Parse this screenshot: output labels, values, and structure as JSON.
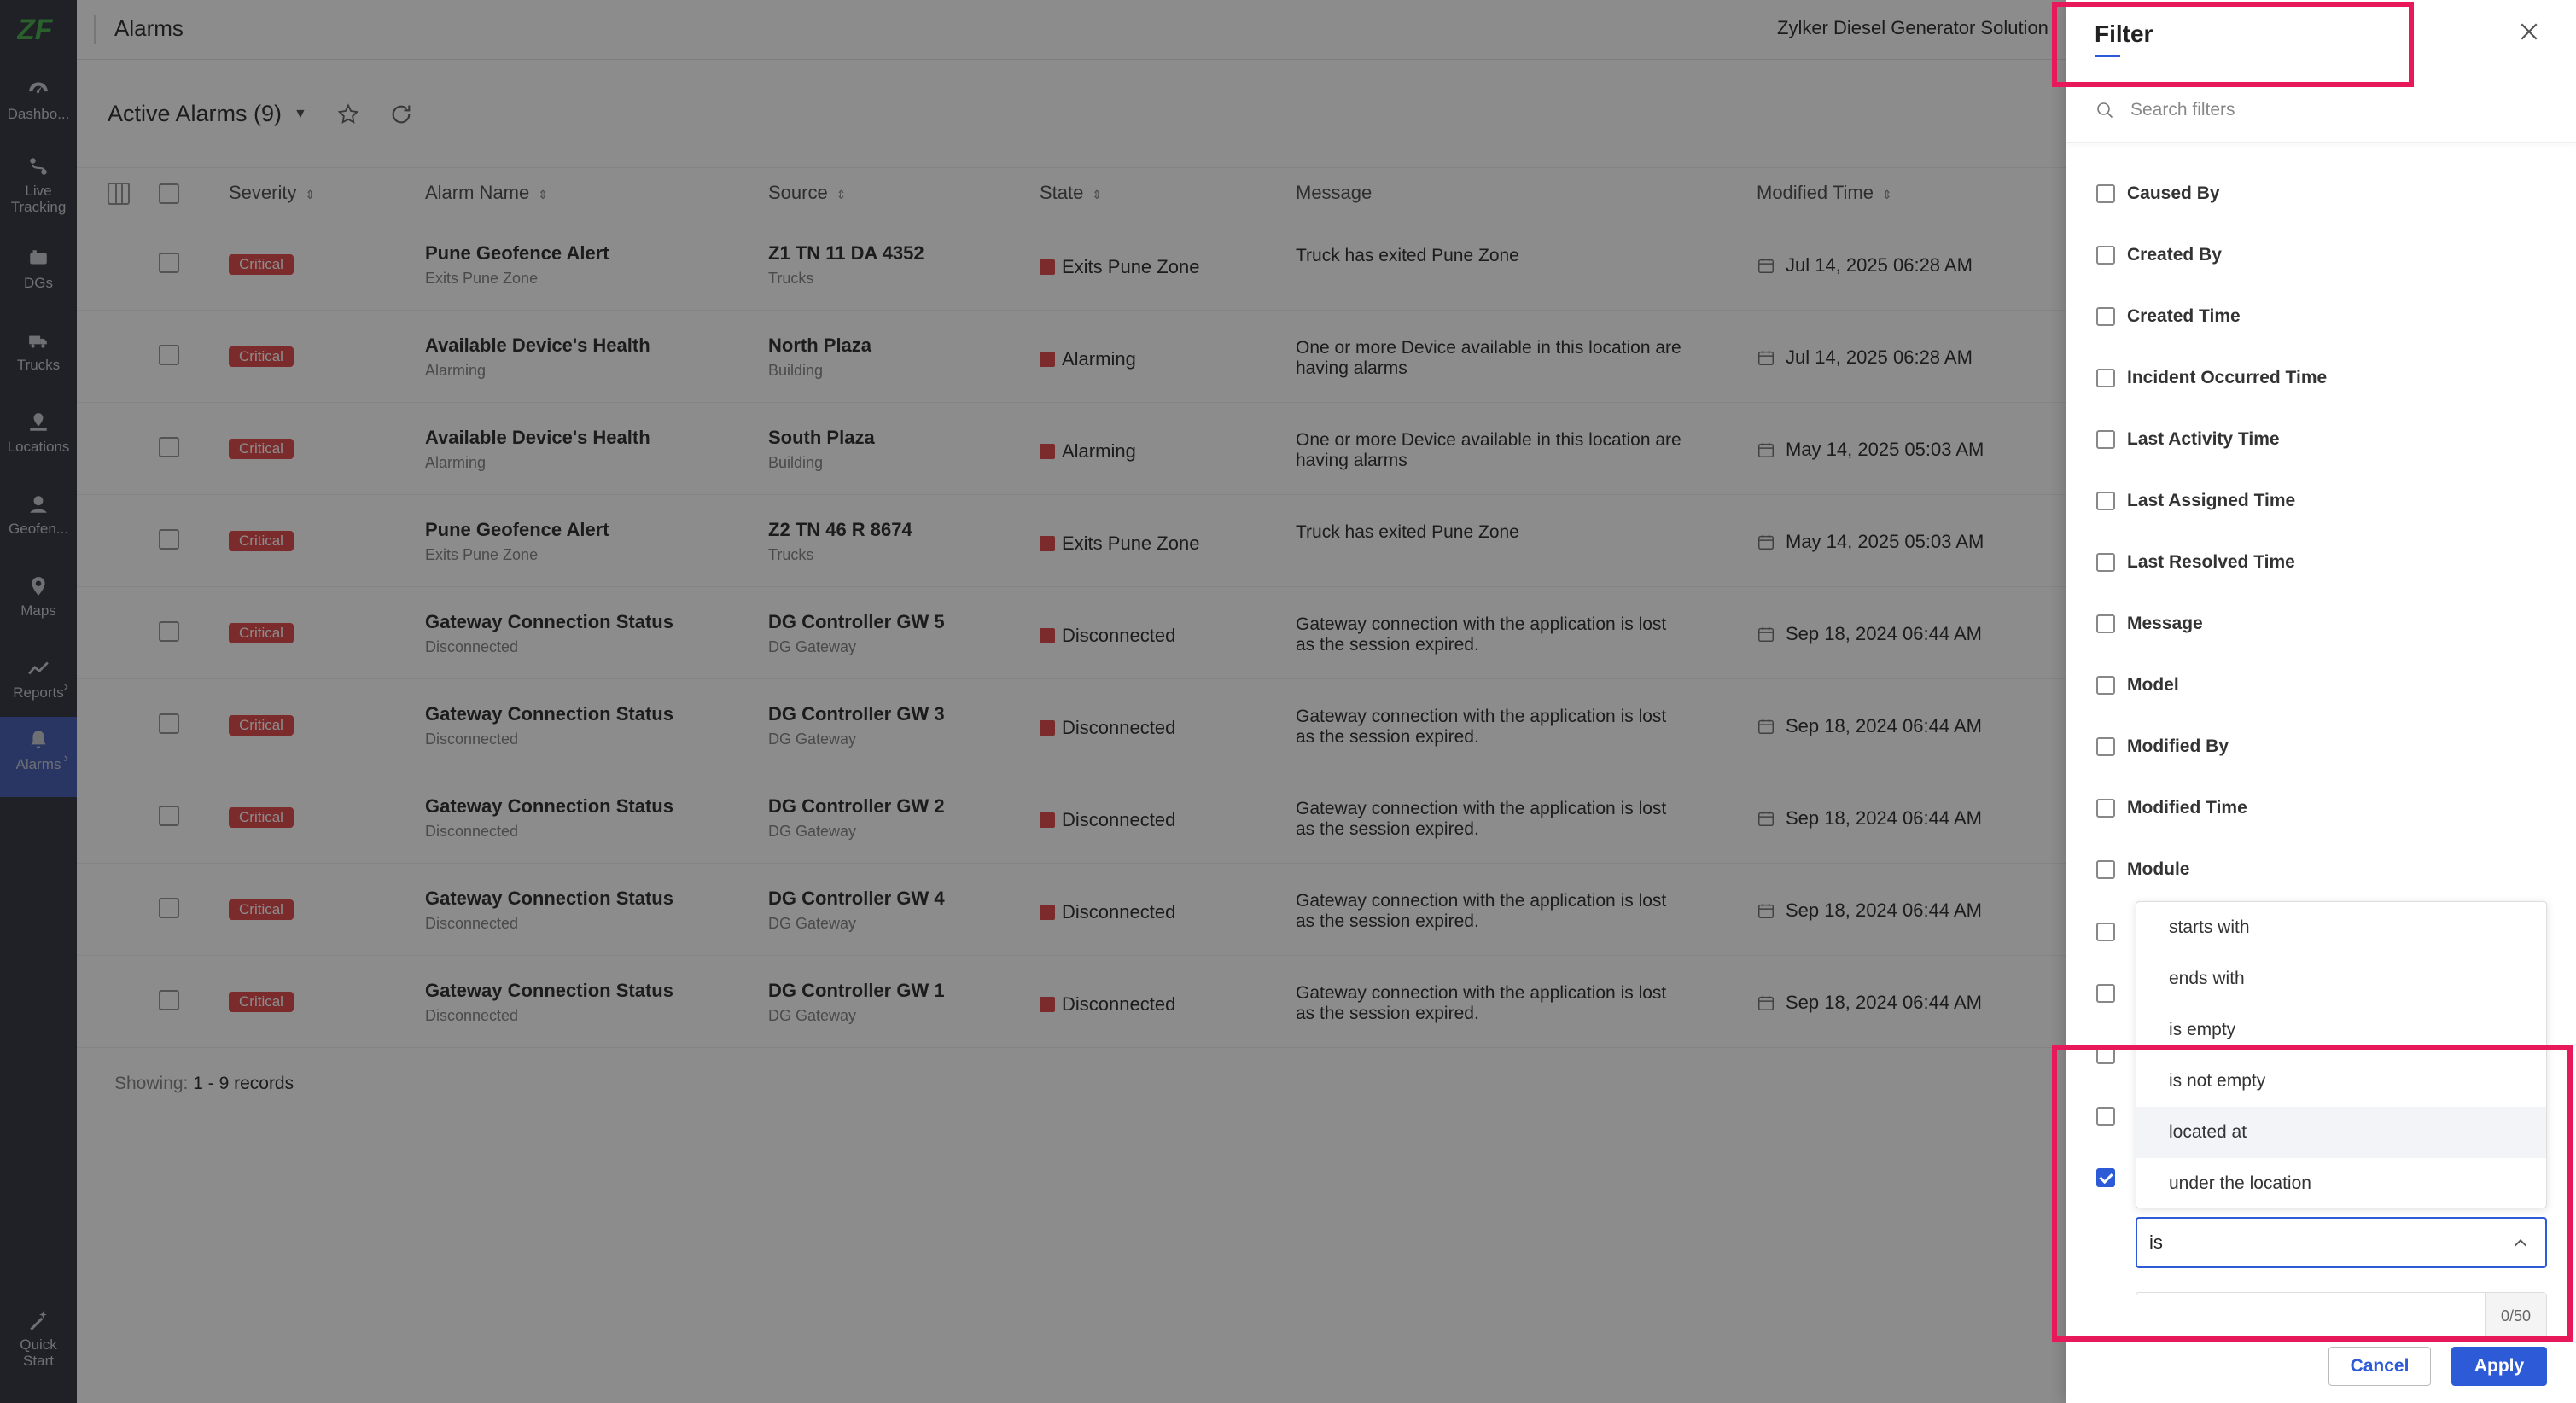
{
  "app": {
    "title": "Alarms",
    "org": "Zylker Diesel Generator Solution"
  },
  "nav": [
    {
      "label": "Dashbo...",
      "icon": "dashboard-icon"
    },
    {
      "label": "Live Tracking",
      "icon": "live-tracking-icon"
    },
    {
      "label": "DGs",
      "icon": "dg-icon"
    },
    {
      "label": "Trucks",
      "icon": "truck-icon"
    },
    {
      "label": "Locations",
      "icon": "locations-icon"
    },
    {
      "label": "Geofen...",
      "icon": "geofence-icon"
    },
    {
      "label": "Maps",
      "icon": "map-pin-icon"
    },
    {
      "label": "Reports",
      "icon": "reports-icon"
    },
    {
      "label": "Alarms",
      "icon": "bell-icon"
    },
    {
      "label": "Quick Start",
      "icon": "magic-wand-icon"
    }
  ],
  "view": {
    "title": "Active Alarms (9)"
  },
  "columns": {
    "severity": "Severity",
    "alarm_name": "Alarm Name",
    "source": "Source",
    "state": "State",
    "message": "Message",
    "modified_time": "Modified Time"
  },
  "rows": [
    {
      "severity": "Critical",
      "name": "Pune Geofence Alert",
      "name_sub": "Exits Pune Zone",
      "source": "Z1 TN 11 DA 4352",
      "source_sub": "Trucks",
      "state": "Exits Pune Zone",
      "message": "Truck has exited Pune Zone",
      "time": "Jul 14, 2025 06:28 AM"
    },
    {
      "severity": "Critical",
      "name": "Available Device's Health",
      "name_sub": "Alarming",
      "source": "North Plaza",
      "source_sub": "Building",
      "state": "Alarming",
      "message": "One or more Device available in this location are having alarms",
      "time": "Jul 14, 2025 06:28 AM"
    },
    {
      "severity": "Critical",
      "name": "Available Device's Health",
      "name_sub": "Alarming",
      "source": "South Plaza",
      "source_sub": "Building",
      "state": "Alarming",
      "message": "One or more Device available in this location are having alarms",
      "time": "May 14, 2025 05:03 AM"
    },
    {
      "severity": "Critical",
      "name": "Pune Geofence Alert",
      "name_sub": "Exits Pune Zone",
      "source": "Z2 TN 46 R 8674",
      "source_sub": "Trucks",
      "state": "Exits Pune Zone",
      "message": "Truck has exited Pune Zone",
      "time": "May 14, 2025 05:03 AM"
    },
    {
      "severity": "Critical",
      "name": "Gateway Connection Status",
      "name_sub": "Disconnected",
      "source": "DG Controller GW 5",
      "source_sub": "DG Gateway",
      "state": "Disconnected",
      "message": "Gateway connection with the application is lost as the session expired.",
      "time": "Sep 18, 2024 06:44 AM"
    },
    {
      "severity": "Critical",
      "name": "Gateway Connection Status",
      "name_sub": "Disconnected",
      "source": "DG Controller GW 3",
      "source_sub": "DG Gateway",
      "state": "Disconnected",
      "message": "Gateway connection with the application is lost as the session expired.",
      "time": "Sep 18, 2024 06:44 AM"
    },
    {
      "severity": "Critical",
      "name": "Gateway Connection Status",
      "name_sub": "Disconnected",
      "source": "DG Controller GW 2",
      "source_sub": "DG Gateway",
      "state": "Disconnected",
      "message": "Gateway connection with the application is lost as the session expired.",
      "time": "Sep 18, 2024 06:44 AM"
    },
    {
      "severity": "Critical",
      "name": "Gateway Connection Status",
      "name_sub": "Disconnected",
      "source": "DG Controller GW 4",
      "source_sub": "DG Gateway",
      "state": "Disconnected",
      "message": "Gateway connection with the application is lost as the session expired.",
      "time": "Sep 18, 2024 06:44 AM"
    },
    {
      "severity": "Critical",
      "name": "Gateway Connection Status",
      "name_sub": "Disconnected",
      "source": "DG Controller GW 1",
      "source_sub": "DG Gateway",
      "state": "Disconnected",
      "message": "Gateway connection with the application is lost as the session expired.",
      "time": "Sep 18, 2024 06:44 AM"
    }
  ],
  "footer": {
    "showing_label": "Showing:",
    "showing_value": "1 - 9 records"
  },
  "filter": {
    "title": "Filter",
    "search_placeholder": "Search filters",
    "items": [
      {
        "label": "Caused By",
        "checked": false
      },
      {
        "label": "Created By",
        "checked": false
      },
      {
        "label": "Created Time",
        "checked": false
      },
      {
        "label": "Incident Occurred Time",
        "checked": false
      },
      {
        "label": "Last Activity Time",
        "checked": false
      },
      {
        "label": "Last Assigned Time",
        "checked": false
      },
      {
        "label": "Last Resolved Time",
        "checked": false
      },
      {
        "label": "Message",
        "checked": false
      },
      {
        "label": "Model",
        "checked": false
      },
      {
        "label": "Modified By",
        "checked": false
      },
      {
        "label": "Modified Time",
        "checked": false
      },
      {
        "label": "Module",
        "checked": false
      }
    ],
    "dropdown_options": [
      "starts with",
      "ends with",
      "is empty",
      "is not empty",
      "located at",
      "under the location"
    ],
    "highlighted_option": "located at",
    "selected_operator": "is",
    "value_input": "",
    "char_count": "0/50",
    "cancel_label": "Cancel",
    "apply_label": "Apply"
  },
  "colors": {
    "accent": "#2d5bd8",
    "critical": "#e14f4f",
    "highlight": "#e8195a",
    "nav_bg": "#3a3d47",
    "nav_active": "#4c63b4"
  }
}
